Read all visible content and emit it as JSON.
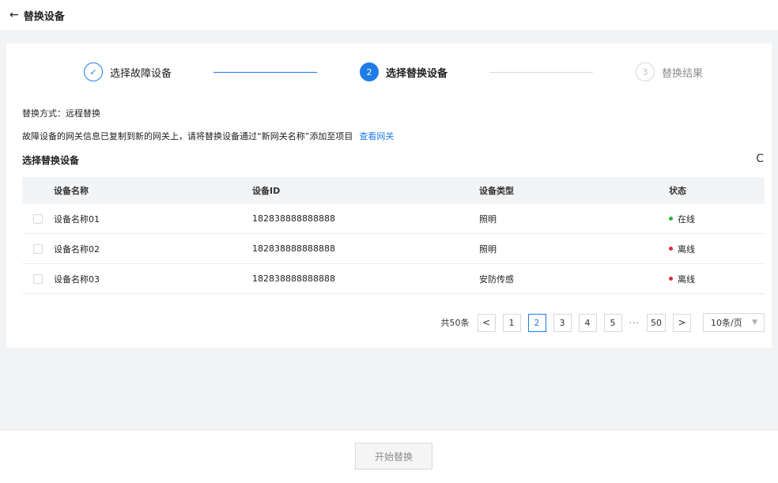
{
  "header": {
    "back_icon": "←",
    "title": "替换设备"
  },
  "steps": [
    {
      "index": "✓",
      "label": "选择故障设备",
      "state": "done"
    },
    {
      "index": "2",
      "label": "选择替换设备",
      "state": "active"
    },
    {
      "index": "3",
      "label": "替换结果",
      "state": "wait"
    }
  ],
  "info": {
    "method": "替换方式：远程替换",
    "notice": "故障设备的网关信息已复制到新的网关上，请将替换设备通过“新网关名称”添加至项目",
    "view_gateway_link": "查看网关"
  },
  "section": {
    "title": "选择替换设备",
    "refresh_icon": "C"
  },
  "table": {
    "columns": [
      "设备名称",
      "设备ID",
      "设备类型",
      "状态"
    ],
    "rows": [
      {
        "name": "设备名称01",
        "id": "182838888888888",
        "type": "照明",
        "status": "在线",
        "status_color": "#27b148"
      },
      {
        "name": "设备名称02",
        "id": "182838888888888",
        "type": "照明",
        "status": "离线",
        "status_color": "#e02a3a"
      },
      {
        "name": "设备名称03",
        "id": "182838888888888",
        "type": "安防传感",
        "status": "离线",
        "status_color": "#e02a3a"
      }
    ]
  },
  "pagination": {
    "total": "共50条",
    "prev": "<",
    "next": ">",
    "pages": [
      "1",
      "2",
      "3",
      "4",
      "5"
    ],
    "active_page": "2",
    "ellipsis": "···",
    "last_page": "50",
    "page_size": "10条/页",
    "caret": "▼"
  },
  "footer": {
    "start_button": "开始替换"
  },
  "colors": {
    "primary": "#1e7de6",
    "online": "#27b148",
    "offline": "#e02a3a"
  }
}
